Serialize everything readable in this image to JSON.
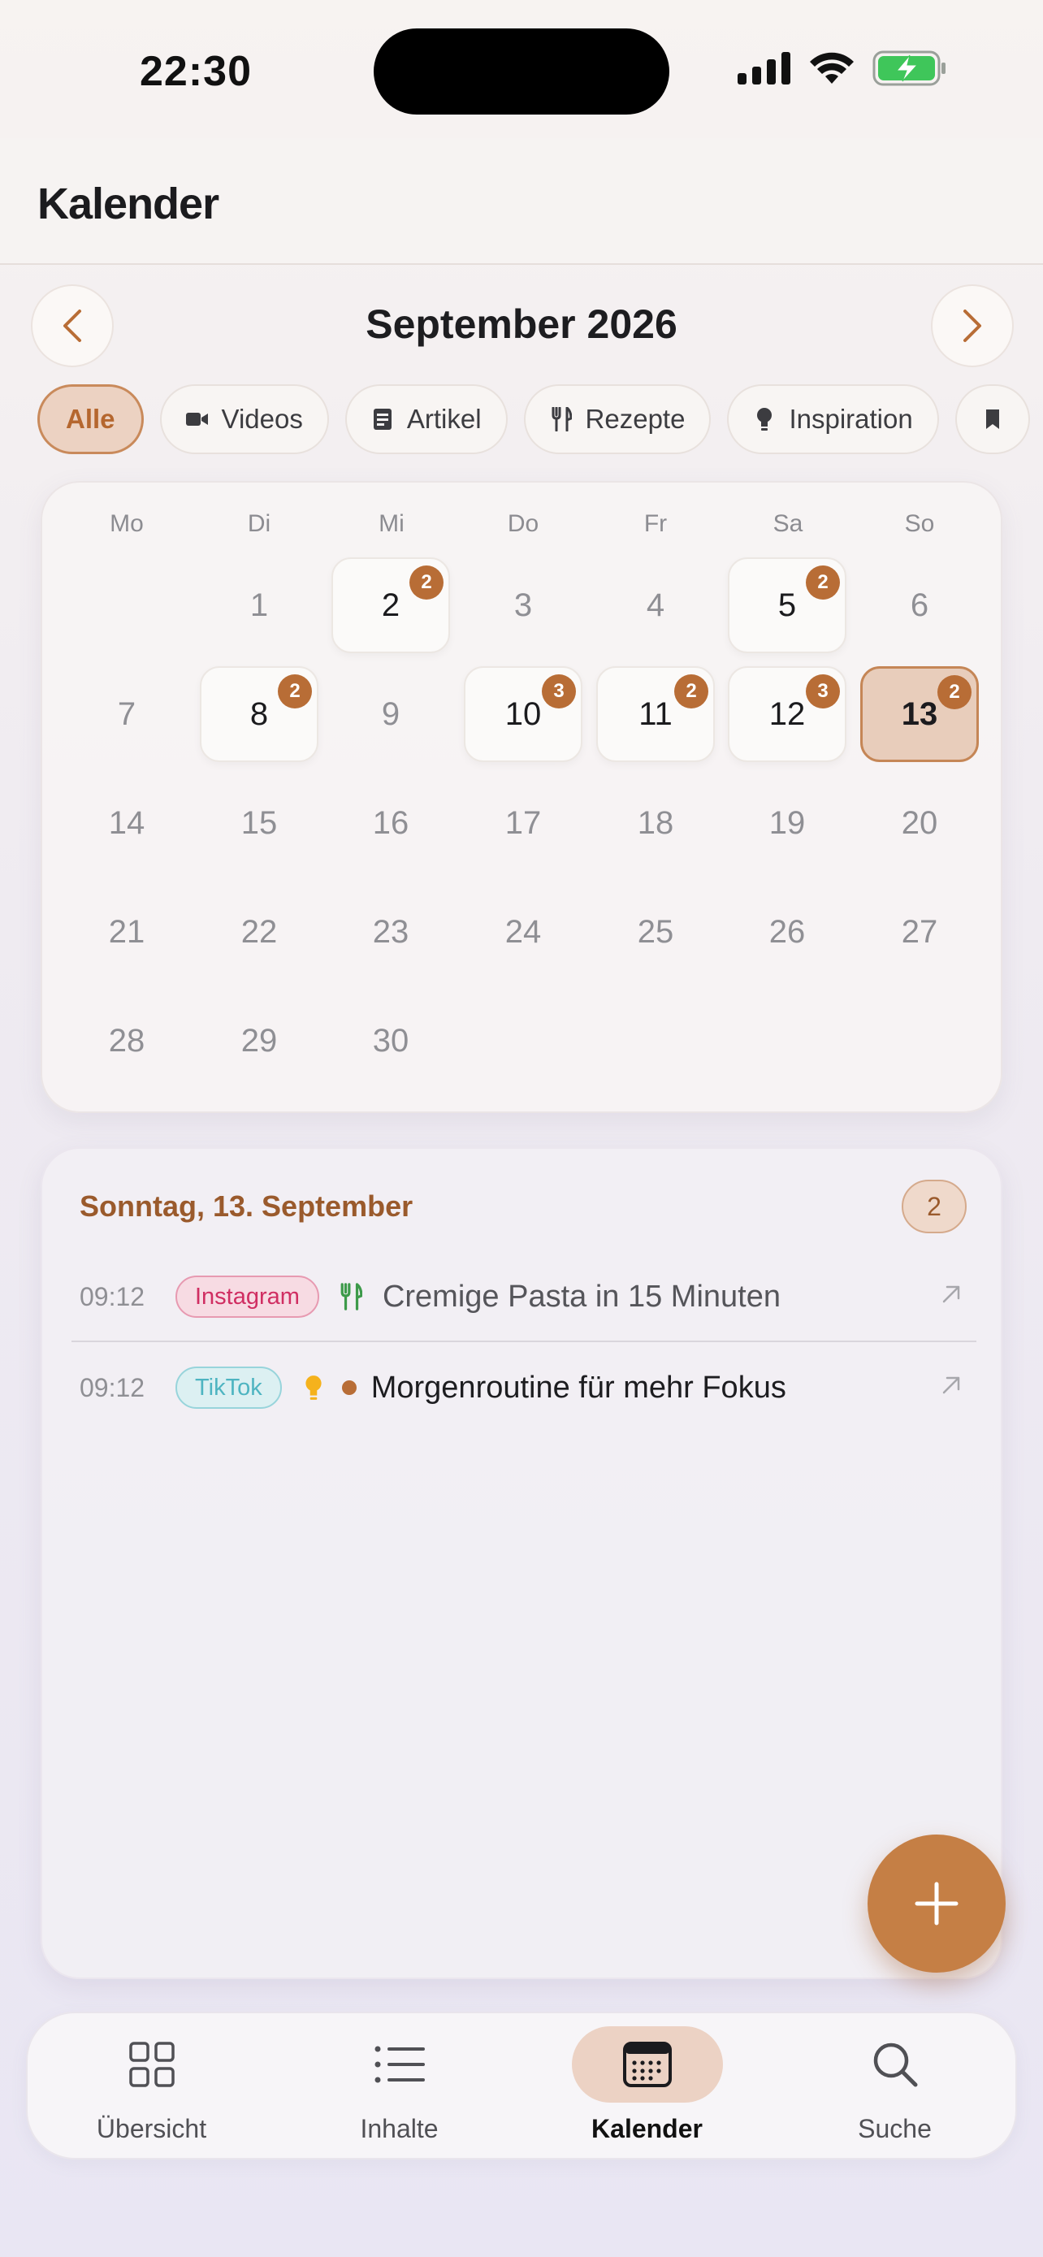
{
  "status_bar": {
    "time": "22:30"
  },
  "header": {
    "title": "Kalender"
  },
  "month_nav": {
    "title": "September 2026"
  },
  "filters": [
    {
      "label": "Alle",
      "icon": "",
      "active": true
    },
    {
      "label": "Videos",
      "icon": "video-icon",
      "active": false
    },
    {
      "label": "Artikel",
      "icon": "article-icon",
      "active": false
    },
    {
      "label": "Rezepte",
      "icon": "fork-knife-icon",
      "active": false
    },
    {
      "label": "Inspiration",
      "icon": "bulb-icon",
      "active": false
    }
  ],
  "calendar": {
    "weekdays": [
      "Mo",
      "Di",
      "Mi",
      "Do",
      "Fr",
      "Sa",
      "So"
    ],
    "days": [
      {
        "label": "1"
      },
      {
        "label": "2",
        "count": "2"
      },
      {
        "label": "3"
      },
      {
        "label": "4"
      },
      {
        "label": "5",
        "count": "2"
      },
      {
        "label": "6"
      },
      {
        "label": "7"
      },
      {
        "label": "8",
        "count": "2"
      },
      {
        "label": "9"
      },
      {
        "label": "10",
        "count": "3"
      },
      {
        "label": "11",
        "count": "2"
      },
      {
        "label": "12",
        "count": "3"
      },
      {
        "label": "13",
        "count": "2",
        "selected": true
      },
      {
        "label": "14"
      },
      {
        "label": "15"
      },
      {
        "label": "16"
      },
      {
        "label": "17"
      },
      {
        "label": "18"
      },
      {
        "label": "19"
      },
      {
        "label": "20"
      },
      {
        "label": "21"
      },
      {
        "label": "22"
      },
      {
        "label": "23"
      },
      {
        "label": "24"
      },
      {
        "label": "25"
      },
      {
        "label": "26"
      },
      {
        "label": "27"
      },
      {
        "label": "28"
      },
      {
        "label": "29"
      },
      {
        "label": "30"
      }
    ]
  },
  "day_detail": {
    "heading": "Sonntag, 13. September",
    "count": "2",
    "items": [
      {
        "time": "09:12",
        "platform": "Instagram",
        "category_icon": "fork-knife-icon",
        "title": "Cremige Pasta in 15 Minuten"
      },
      {
        "time": "09:12",
        "platform": "TikTok",
        "category_icon": "bulb-icon",
        "title": "Morgenroutine für mehr Fokus"
      }
    ]
  },
  "tabbar": [
    {
      "label": "Übersicht",
      "icon": "grid-icon",
      "active": false
    },
    {
      "label": "Inhalte",
      "icon": "list-icon",
      "active": false
    },
    {
      "label": "Kalender",
      "icon": "calendar-icon",
      "active": true
    },
    {
      "label": "Suche",
      "icon": "search-icon",
      "active": false
    }
  ],
  "colors": {
    "accent": "#c57f45",
    "accent_dark": "#b86d36",
    "instagram": "#d02e62",
    "tiktok": "#4eb4c1"
  }
}
